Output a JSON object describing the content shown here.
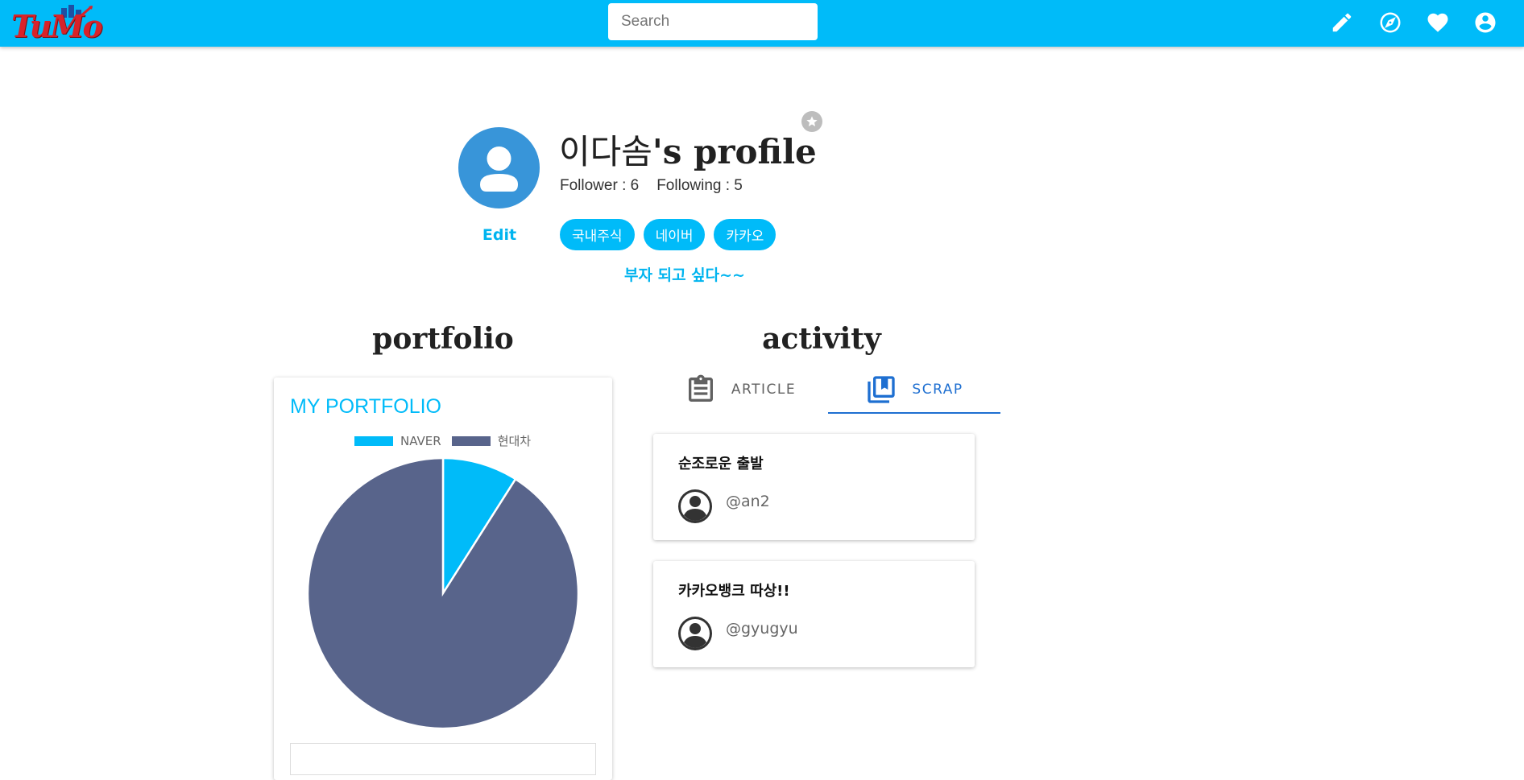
{
  "app": {
    "logo_text": "TuMo"
  },
  "search": {
    "placeholder": "Search",
    "value": ""
  },
  "top_icons": [
    "pencil-icon",
    "compass-icon",
    "heart-icon",
    "account-circle-icon"
  ],
  "profile": {
    "name": "이다솜",
    "title_suffix": "'s profile",
    "follower_text": "Follower : 6",
    "following_text": "Following : 5",
    "edit_label": "Edit",
    "tags": [
      "국내주식",
      "네이버",
      "카카오"
    ],
    "bio": "부자 되고 싶다~~"
  },
  "sections": {
    "portfolio_heading": "portfolio",
    "activity_heading": "activity"
  },
  "portfolio": {
    "card_title": "MY PORTFOLIO",
    "colors": {
      "NAVER": "#00bbf9",
      "현대차": "#58648b"
    }
  },
  "chart_data": {
    "type": "pie",
    "labels": [
      "NAVER",
      "현대차"
    ],
    "values": [
      9,
      91
    ],
    "legend": "top"
  },
  "tabs": [
    {
      "label": "ARTICLE",
      "icon": "clipboard-icon",
      "active": false
    },
    {
      "label": "SCRAP",
      "icon": "bookmarks-icon",
      "active": true
    }
  ],
  "scraps": [
    {
      "title": "순조로운 출발",
      "author": "@an2"
    },
    {
      "title": "카카오뱅크 따상!!",
      "author": "@gyugyu"
    }
  ]
}
